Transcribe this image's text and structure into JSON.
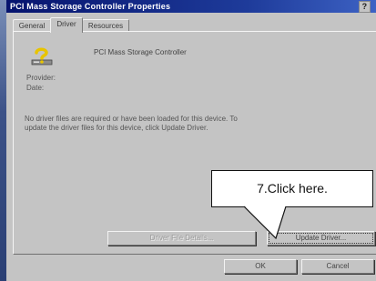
{
  "window": {
    "title": "PCI Mass Storage Controller Properties",
    "help_glyph": "?"
  },
  "tabs": [
    {
      "label": "General",
      "active": false
    },
    {
      "label": "Driver",
      "active": true
    },
    {
      "label": "Resources",
      "active": false
    }
  ],
  "device": {
    "name": "PCI Mass Storage Controller",
    "icon": "unknown-device-question-icon"
  },
  "fields": {
    "provider_label": "Provider:",
    "date_label": "Date:"
  },
  "message": {
    "line1": "No driver files are required or have been loaded for this device.  To",
    "line2": "update the driver files for this device, click Update Driver."
  },
  "buttons": {
    "driver_file_details": "Driver File Details...",
    "update_driver": "Update Driver...",
    "ok": "OK",
    "cancel": "Cancel"
  },
  "callout": {
    "text": "7.Click here."
  }
}
